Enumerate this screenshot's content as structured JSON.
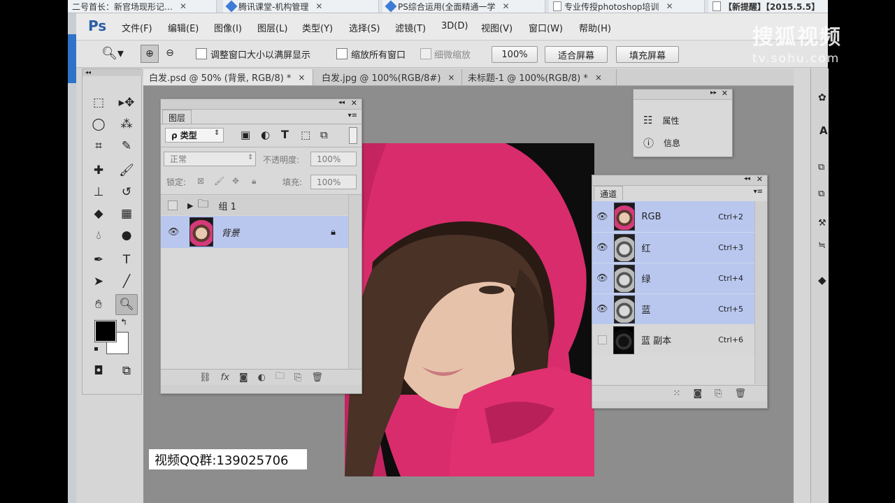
{
  "browser_tabs": [
    {
      "label": "二号首长：新官场现形记…",
      "x_close": "✕"
    },
    {
      "label": "腾讯课堂-机构管理",
      "x_close": "✕"
    },
    {
      "label": "PS综合运用(全面精通一学",
      "x_close": "✕"
    },
    {
      "label": "专业传授photoshop培训",
      "x_close": "✕"
    },
    {
      "label": "【新提醒】【2015.5.5】",
      "x_close": ""
    }
  ],
  "app": {
    "logo": "Ps"
  },
  "menu": [
    "文件(F)",
    "编辑(E)",
    "图像(I)",
    "图层(L)",
    "类型(Y)",
    "选择(S)",
    "滤镜(T)",
    "3D(D)",
    "视图(V)",
    "窗口(W)",
    "帮助(H)"
  ],
  "options": {
    "resize_window": "调整窗口大小以满屏显示",
    "zoom_all": "缩放所有窗口",
    "scrubby_zoom": "细微缩放",
    "zoom_value": "100%",
    "fit_screen": "适合屏幕",
    "fill_screen": "填充屏幕"
  },
  "doc_tabs": [
    {
      "label": "白发.psd @ 50% (背景, RGB/8) *",
      "close": "×"
    },
    {
      "label": "白发.jpg @ 100%(RGB/8#)",
      "close": "×"
    },
    {
      "label": "未标题-1 @ 100%(RGB/8) *",
      "close": "×"
    }
  ],
  "layers_panel": {
    "tab": "图层",
    "filter_label": "ρ 类型",
    "blend_mode": "正常",
    "opacity_label": "不透明度:",
    "opacity_value": "100%",
    "lock_label": "锁定:",
    "fill_label": "填充:",
    "fill_value": "100%",
    "layers": [
      {
        "name": "组 1",
        "type": "group",
        "visible": false
      },
      {
        "name": "背景",
        "type": "image",
        "visible": true,
        "locked": true
      }
    ]
  },
  "properties_panel": {
    "items": [
      {
        "label": "属性",
        "icon": "properties-icon"
      },
      {
        "label": "信息",
        "icon": "info-icon"
      }
    ]
  },
  "channels_panel": {
    "tab": "通道",
    "channels": [
      {
        "name": "RGB",
        "shortcut": "Ctrl+2",
        "visible": true,
        "selected": true
      },
      {
        "name": "红",
        "shortcut": "Ctrl+3",
        "visible": true,
        "selected": true
      },
      {
        "name": "绿",
        "shortcut": "Ctrl+4",
        "visible": true,
        "selected": true
      },
      {
        "name": "蓝",
        "shortcut": "Ctrl+5",
        "visible": true,
        "selected": true
      },
      {
        "name": "蓝 副本",
        "shortcut": "Ctrl+6",
        "visible": false,
        "selected": false
      }
    ]
  },
  "watermark": {
    "brand": "搜狐视频",
    "url": "tv.sohu.com"
  },
  "qq_group": "视频QQ群:139025706",
  "colors": {
    "selection": "#b9c7ef",
    "ps_blue": "#2b5fa8",
    "hood_pink": "#e0306f"
  }
}
